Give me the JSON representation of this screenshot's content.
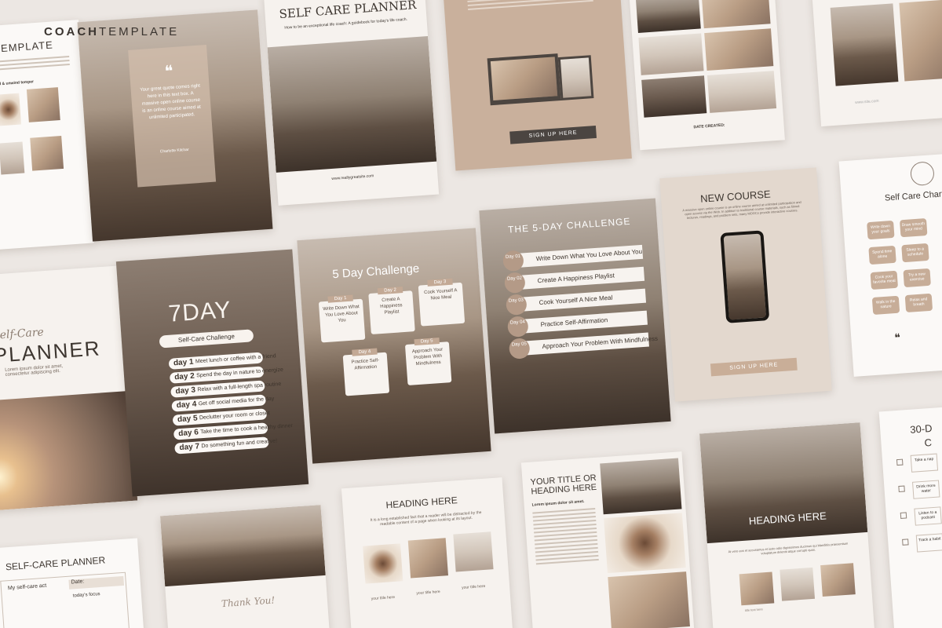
{
  "brand": {
    "bold": "COACH",
    "light": "TEMPLATE"
  },
  "quote_page": {
    "quote": "Your great quote comes right here in this text box. A massive open online course is an online course aimed at unlimited participated.",
    "author": "Charlotte Kilchar"
  },
  "self_care_top": {
    "title": "SELF CARE PLANNER",
    "subtitle": "How to be an exceptional life coach: A guidebook for today's life coach.",
    "url": "www.reallygreatsite.com"
  },
  "signup_page": {
    "button": "SIGN UP HERE"
  },
  "collage_page": {
    "date": "DATE CREATED:"
  },
  "left_edge": {
    "template_title": "TEMPLATE",
    "checklist_heading": "ed & unwind temper"
  },
  "site_footer": {
    "text": "www.site.com"
  },
  "planner_cover": {
    "script": "Self-Care",
    "title": "PLANNER",
    "body": "Lorem ipsum dolor sit amet, consectetur adipiscing elit."
  },
  "seven_day": {
    "title": "7DAY",
    "subtitle": "Self-Care Challenge",
    "days": [
      {
        "label": "day 1",
        "text": "Meet lunch or coffee with a friend"
      },
      {
        "label": "day 2",
        "text": "Spend the day in nature to energize"
      },
      {
        "label": "day 3",
        "text": "Relax with a full-length spa routine"
      },
      {
        "label": "day 4",
        "text": "Get off social media for the day"
      },
      {
        "label": "day 5",
        "text": "Declutter your room or closet"
      },
      {
        "label": "day 6",
        "text": "Take the time to cook a healthy dinner"
      },
      {
        "label": "day 7",
        "text": "Do something fun and creative!"
      }
    ]
  },
  "five_day": {
    "title": "5 Day Challenge",
    "cards": [
      {
        "day": "Day 1",
        "text": "Write Down What You Love About You"
      },
      {
        "day": "Day 2",
        "text": "Create A Happiness Playlist"
      },
      {
        "day": "Day 3",
        "text": "Cook Yourself A Nice Meal"
      },
      {
        "day": "Day 4",
        "text": "Practice Self-Affirmation"
      },
      {
        "day": "Day 5",
        "text": "Approach Your Problem With Mindfulness"
      }
    ]
  },
  "five_day_challenge": {
    "title": "THE 5-DAY CHALLENGE",
    "rows": [
      {
        "day": "Day 01",
        "text": "Write Down What You Love About You"
      },
      {
        "day": "Day 02",
        "text": "Create A Happiness Playlist"
      },
      {
        "day": "Day 03",
        "text": "Cook Yourself A Nice Meal"
      },
      {
        "day": "Day 04",
        "text": "Practice Self-Affirmation"
      },
      {
        "day": "Day 05",
        "text": "Approach Your Problem With Mindfulness"
      }
    ]
  },
  "new_course": {
    "title": "NEW COURSE",
    "body": "A massive open online course is an online course aimed at unlimited participation and open access via the Web. In addition to traditional course materials, such as filmed lectures, readings, and problem sets, many MOOCs provide interactive courses.",
    "button": "SIGN UP HERE"
  },
  "care_chart": {
    "title": "Self Care Chart",
    "bubbles": [
      "Write down your goals",
      "Draw smooth your mind",
      "Spend time alone",
      "Sleep to a schedule",
      "Cook your favorite meal",
      "Try a new exercise",
      "Walk in the nature",
      "Relax and breath"
    ]
  },
  "bottom_planner": {
    "title": "SELF-CARE PLANNER",
    "col1": "My self-care act",
    "col2": "Date:",
    "sub": "today's focus"
  },
  "thank_you": {
    "text": "Thank You!"
  },
  "heading_page": {
    "title": "HEADING HERE",
    "body": "It is a long established fact that a reader will be distracted by the readable content of a page when looking at its layout.",
    "captions": [
      "your title here",
      "your title here",
      "your title here"
    ]
  },
  "your_title": {
    "title": "YOUR TITLE OR HEADING HERE",
    "lead": "Lorem ipsum dolor sit amet."
  },
  "heading_photo": {
    "title": "HEADING HERE",
    "body": "At vero eos et accusamus et iusto odio dignissimos ducimus qui blanditiis praesentium voluptatum deleniti atque corrupti quos.",
    "caption": "title text here"
  },
  "thirty_day": {
    "title": "30-D",
    "letter": "C",
    "items": [
      "Take a nap",
      "Drink more water",
      "Listen to a podcast",
      "Track a habit"
    ]
  }
}
